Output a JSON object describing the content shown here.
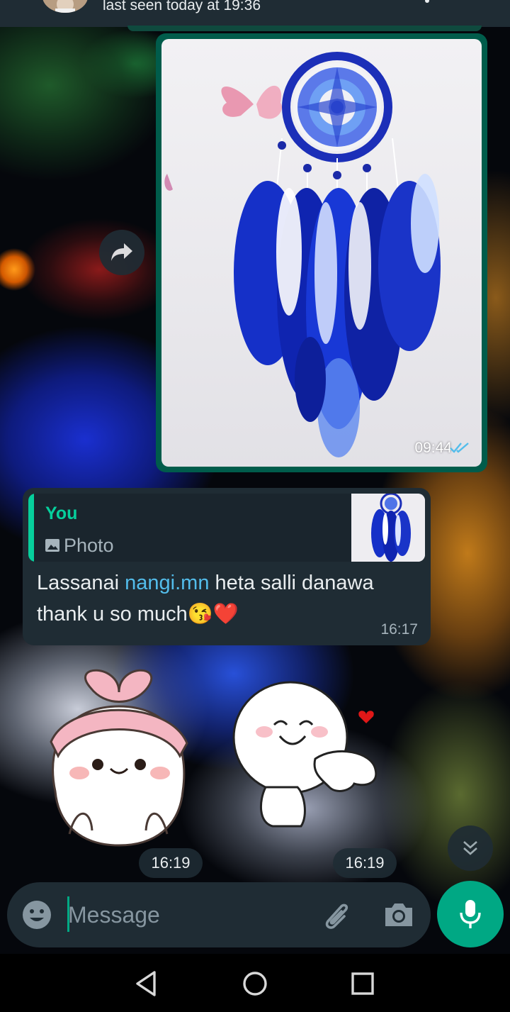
{
  "header": {
    "last_seen": "last seen today at 19:36"
  },
  "messages": {
    "outgoing_photo": {
      "time": "09:44",
      "status": "read-double-tick"
    },
    "incoming_reply": {
      "quoted_sender": "You",
      "quoted_type": "Photo",
      "text_before": "Lassanai ",
      "mention": "nangi.mn",
      "text_after": " heta salli danawa thank u so much😘❤️",
      "time": "16:17"
    },
    "stickers": [
      {
        "time": "16:19"
      },
      {
        "time": "16:19"
      }
    ]
  },
  "composer": {
    "placeholder": "Message"
  },
  "icons": {
    "forward": "forward-icon",
    "scroll_down": "double-chevron-down-icon",
    "emoji": "emoji-icon",
    "attach": "paperclip-icon",
    "camera": "camera-icon",
    "mic": "mic-icon",
    "nav_back": "triangle-back-icon",
    "nav_home": "circle-home-icon",
    "nav_recents": "square-recents-icon"
  },
  "colors": {
    "accent": "#00a884",
    "outgoing_bubble": "#005c4b",
    "incoming_bubble": "#1f2c34",
    "quote_bar": "#06cf9c",
    "link": "#53bdeb",
    "read_ticks": "#53bdeb"
  }
}
